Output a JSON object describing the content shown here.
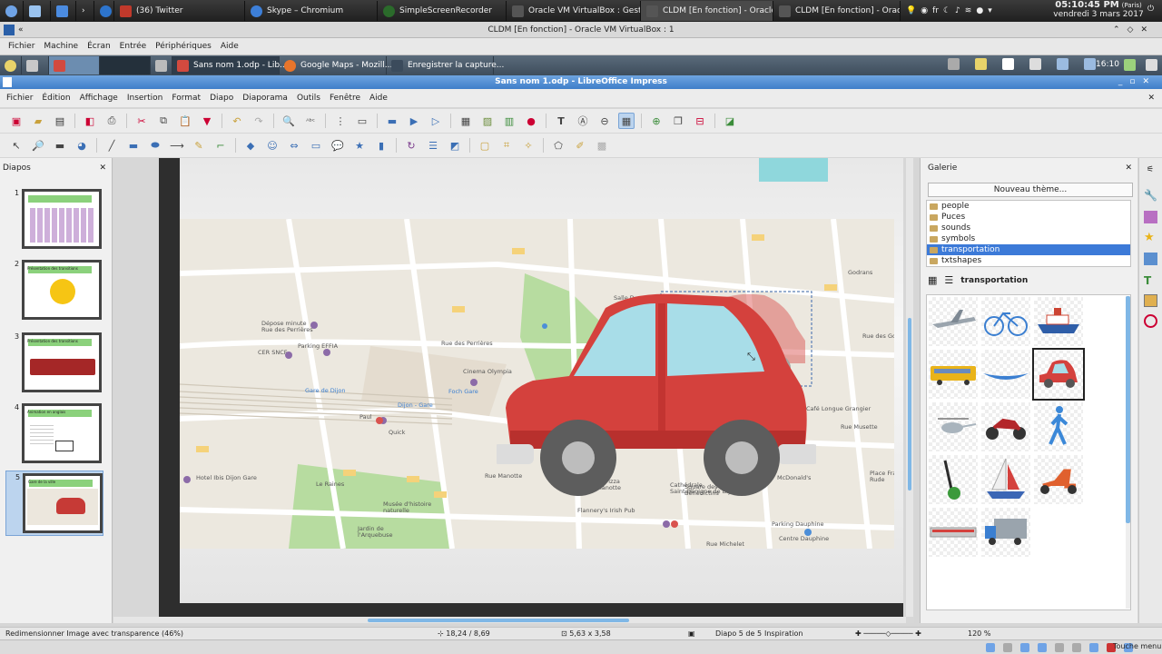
{
  "host_taskbar": {
    "tasks": [
      {
        "label": "(36) Twitter",
        "color": "#c0392b"
      },
      {
        "label": "Skype – Chromium",
        "color": "#3d7fd8"
      },
      {
        "label": "SimpleScreenRecorder",
        "color": "#2a2a2a"
      },
      {
        "label": "Oracle VM VirtualBox : Gesti...",
        "color": "#2a2a2a"
      },
      {
        "label": "CLDM [En fonction] - Oracle ...",
        "color": "#2a2a2a"
      },
      {
        "label": "CLDM [En fonction] - Oracle ...",
        "color": "#2a2a2a"
      }
    ],
    "keyboard_layout": "fr",
    "clock_time": "05:10:45 PM",
    "clock_zone": "(Paris)",
    "clock_date": "vendredi 3 mars 2017"
  },
  "vbox": {
    "title": "CLDM [En fonction] - Oracle VM VirtualBox : 1",
    "menu": [
      "Fichier",
      "Machine",
      "Écran",
      "Entrée",
      "Périphériques",
      "Aide"
    ]
  },
  "guest_panel": {
    "tasks": [
      "Sans nom 1.odp - Lib...",
      "Google Maps - Mozill...",
      "Enregistrer la capture..."
    ],
    "clock": "16:10"
  },
  "lo": {
    "title": "Sans nom 1.odp - LibreOffice Impress",
    "menu": [
      "Fichier",
      "Édition",
      "Affichage",
      "Insertion",
      "Format",
      "Diapo",
      "Diaporama",
      "Outils",
      "Fenêtre",
      "Aide"
    ]
  },
  "slides_panel": {
    "title": "Diapos",
    "slides": [
      {
        "number": "1",
        "caption": ""
      },
      {
        "number": "2",
        "caption": "Présentation des transitions"
      },
      {
        "number": "3",
        "caption": "Présentation des transitions"
      },
      {
        "number": "4",
        "caption": "Animation en anglais"
      },
      {
        "number": "5",
        "caption": "Gare de la ville"
      }
    ]
  },
  "map_labels": [
    {
      "text": "Rue des Perrières"
    },
    {
      "text": "Dépose minute\nRue des Perrières"
    },
    {
      "text": "Parking EFFIA"
    },
    {
      "text": "CER SNCF"
    },
    {
      "text": "Cinema Olympia"
    },
    {
      "text": "Gare de Dijon"
    },
    {
      "text": "Dijon - Gare"
    },
    {
      "text": "Foch Gare"
    },
    {
      "text": "Paul"
    },
    {
      "text": "Quick"
    },
    {
      "text": "Hotel Ibis Dijon Gare"
    },
    {
      "text": "Le Raines"
    },
    {
      "text": "Musée d'histoire\nnaturelle"
    },
    {
      "text": "Jardin de\nl'Arquebuse"
    },
    {
      "text": "Domino's Pizza\nDijon - Manotte"
    },
    {
      "text": "Flannery's Irish Pub"
    },
    {
      "text": "Cathédrale\nSaint-Bénigne de Dijon"
    },
    {
      "text": "Square des\nBénédictins"
    },
    {
      "text": "Parking Dauphine"
    },
    {
      "text": "Centre Dauphine"
    },
    {
      "text": "Rue Michelet"
    },
    {
      "text": "Place François\nRude"
    },
    {
      "text": "Rue Musette"
    },
    {
      "text": "McDonald's"
    },
    {
      "text": "Café Longue Grangier"
    },
    {
      "text": "Rue Manotte"
    },
    {
      "text": "Salle Devosge"
    },
    {
      "text": "Godrans"
    },
    {
      "text": "Rue des Godrans"
    }
  ],
  "gallery": {
    "title": "Galerie",
    "new_theme": "Nouveau thème...",
    "themes": [
      "people",
      "Puces",
      "sounds",
      "symbols",
      "transportation",
      "txtshapes"
    ],
    "selected_theme": "transportation",
    "current_theme_label": "transportation",
    "items": [
      "airplane",
      "bicycle",
      "ship",
      "bus",
      "canoe",
      "car",
      "helicopter",
      "motorcycle",
      "pedestrian",
      "segway",
      "sailboat",
      "scooter",
      "train",
      "truck"
    ]
  },
  "status": {
    "action": "Redimensionner Image avec transparence (46%)",
    "position": "18,24 / 8,69",
    "size": "5,63 x 3,58",
    "slide": "Diapo 5 de 5",
    "master": "Inspiration",
    "zoom": "120 %"
  },
  "bottom_tray": {
    "label": "Touche menu"
  }
}
